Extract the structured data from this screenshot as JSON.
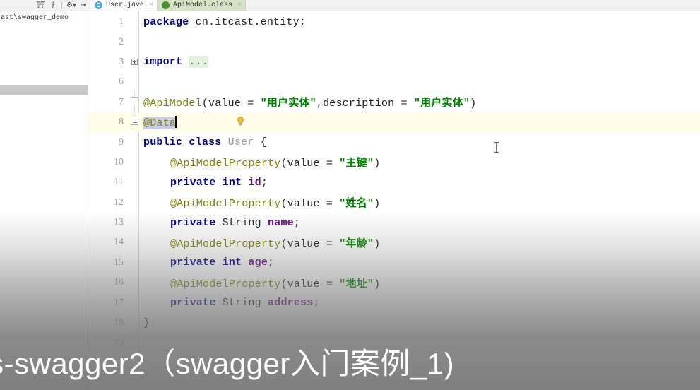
{
  "toolbar": {
    "icons": [
      {
        "name": "collapse-all-icon",
        "glyph": "⊖"
      },
      {
        "name": "expand-all-icon",
        "glyph": "⨍"
      },
      {
        "name": "settings-gear-icon",
        "glyph": "⚙"
      },
      {
        "name": "hide-panel-icon",
        "glyph": "⇥"
      }
    ]
  },
  "sidebar": {
    "breadcrumb_path": "ast\\swagger_demo"
  },
  "tabs": [
    {
      "label": "User.java",
      "icon": "java-class-icon",
      "icon_glyph": "C",
      "active": false,
      "close_glyph": "×"
    },
    {
      "label": "ApiModel.class",
      "icon": "annotation-icon",
      "icon_glyph": "@",
      "active": true,
      "close_glyph": "×"
    }
  ],
  "editor": {
    "current_line": 8,
    "lines": [
      {
        "num": "1",
        "fold": "none",
        "tokens": [
          {
            "t": "package",
            "c": "kw"
          },
          {
            "t": " cn.itcast.entity;",
            "c": "plain"
          }
        ]
      },
      {
        "num": "2",
        "fold": "none",
        "tokens": []
      },
      {
        "num": "3",
        "fold": "plus",
        "tokens": [
          {
            "t": "import",
            "c": "kw"
          },
          {
            "t": " ",
            "c": "plain"
          },
          {
            "t": "...",
            "c": "dots"
          }
        ]
      },
      {
        "num": "6",
        "fold": "none",
        "tokens": []
      },
      {
        "num": "7",
        "fold": "top",
        "tokens": [
          {
            "t": "@ApiModel",
            "c": "ann"
          },
          {
            "t": "(value = ",
            "c": "plain"
          },
          {
            "t": "\"用户实体\"",
            "c": "str"
          },
          {
            "t": ",description = ",
            "c": "plain"
          },
          {
            "t": "\"用户实体\"",
            "c": "str"
          },
          {
            "t": ")",
            "c": "plain"
          }
        ]
      },
      {
        "num": "8",
        "fold": "bot",
        "current": true,
        "tokens": [
          {
            "t": "@Data",
            "c": "ann sel"
          }
        ],
        "caret_after": true
      },
      {
        "num": "9",
        "fold": "none",
        "tokens": [
          {
            "t": "public class",
            "c": "kw"
          },
          {
            "t": " ",
            "c": "plain"
          },
          {
            "t": "User",
            "c": "cls-name"
          },
          {
            "t": " {",
            "c": "plain"
          }
        ]
      },
      {
        "num": "10",
        "fold": "none",
        "indent": 2,
        "tokens": [
          {
            "t": "@ApiModelProperty",
            "c": "ann"
          },
          {
            "t": "(value = ",
            "c": "plain"
          },
          {
            "t": "\"主键\"",
            "c": "str"
          },
          {
            "t": ")",
            "c": "plain"
          }
        ]
      },
      {
        "num": "11",
        "fold": "none",
        "indent": 2,
        "tokens": [
          {
            "t": "private int",
            "c": "kw"
          },
          {
            "t": " ",
            "c": "plain"
          },
          {
            "t": "id",
            "c": "fld"
          },
          {
            "t": ";",
            "c": "plain"
          }
        ]
      },
      {
        "num": "12",
        "fold": "none",
        "indent": 2,
        "tokens": [
          {
            "t": "@ApiModelProperty",
            "c": "ann"
          },
          {
            "t": "(value = ",
            "c": "plain"
          },
          {
            "t": "\"姓名\"",
            "c": "str"
          },
          {
            "t": ")",
            "c": "plain"
          }
        ]
      },
      {
        "num": "13",
        "fold": "none",
        "indent": 2,
        "tokens": [
          {
            "t": "private",
            "c": "kw"
          },
          {
            "t": " String ",
            "c": "plain"
          },
          {
            "t": "name",
            "c": "fld"
          },
          {
            "t": ";",
            "c": "plain"
          }
        ]
      },
      {
        "num": "14",
        "fold": "none",
        "indent": 2,
        "tokens": [
          {
            "t": "@ApiModelProperty",
            "c": "ann"
          },
          {
            "t": "(value = ",
            "c": "plain"
          },
          {
            "t": "\"年龄\"",
            "c": "str"
          },
          {
            "t": ")",
            "c": "plain"
          }
        ]
      },
      {
        "num": "15",
        "fold": "none",
        "indent": 2,
        "tokens": [
          {
            "t": "private int",
            "c": "kw"
          },
          {
            "t": " ",
            "c": "plain"
          },
          {
            "t": "age",
            "c": "fld"
          },
          {
            "t": ";",
            "c": "plain"
          }
        ]
      },
      {
        "num": "16",
        "fold": "none",
        "indent": 2,
        "tokens": [
          {
            "t": "@ApiModelProperty",
            "c": "ann"
          },
          {
            "t": "(value = ",
            "c": "plain"
          },
          {
            "t": "\"地址\"",
            "c": "str"
          },
          {
            "t": ")",
            "c": "plain"
          }
        ]
      },
      {
        "num": "17",
        "fold": "none",
        "indent": 2,
        "tokens": [
          {
            "t": "private",
            "c": "kw"
          },
          {
            "t": " String ",
            "c": "plain"
          },
          {
            "t": "address",
            "c": "fld"
          },
          {
            "t": ";",
            "c": "plain"
          }
        ]
      },
      {
        "num": "18",
        "fold": "none",
        "tokens": [
          {
            "t": "}",
            "c": "plain"
          }
        ]
      },
      {
        "num": "19",
        "fold": "none",
        "tokens": []
      }
    ]
  },
  "caption": {
    "text": "s-swagger2（swagger入门案例_1)"
  },
  "colors": {
    "keyword": "#000080",
    "annotation": "#808000",
    "string": "#008000",
    "field": "#660e7a",
    "current_line_bg": "#fffce8",
    "selection_bg": "#c7cbe8",
    "active_tab_bg": "#d6e2c4"
  }
}
